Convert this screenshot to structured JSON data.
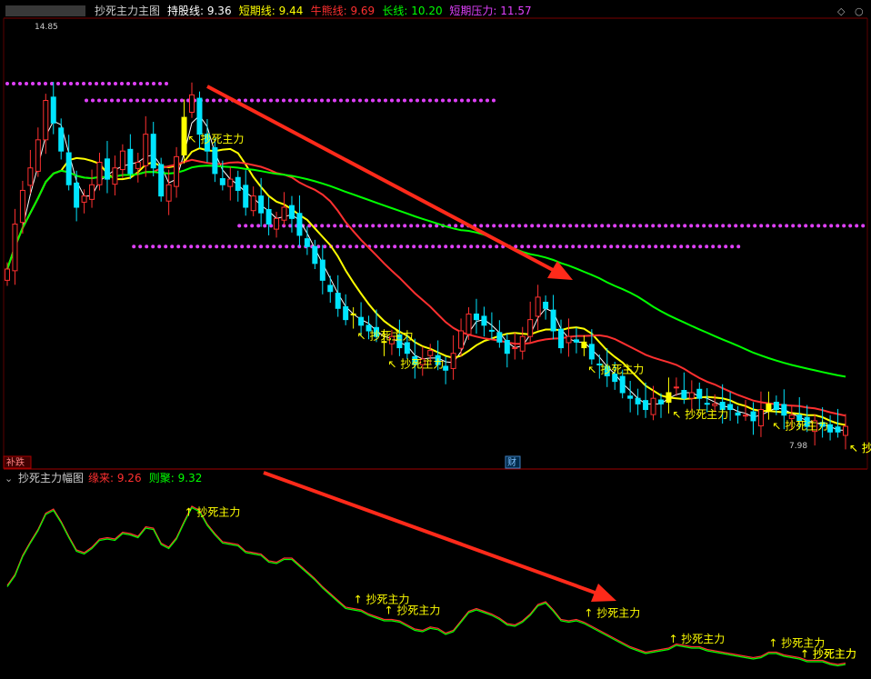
{
  "main_panel": {
    "title": "抄死主力主图",
    "indicators": [
      {
        "label": "持股线",
        "value": "9.36",
        "color": "#ffffff"
      },
      {
        "label": "短期线",
        "value": "9.44",
        "color": "#ffff00"
      },
      {
        "label": "牛熊线",
        "value": "9.69",
        "color": "#ff3030"
      },
      {
        "label": "长线",
        "value": "10.20",
        "color": "#00ff00"
      },
      {
        "label": "短期压力",
        "value": "11.57",
        "color": "#e040fb"
      }
    ],
    "price_high_label": "14.85",
    "price_low_label": "7.98",
    "badge_left": "补跌",
    "badge_mid": "财"
  },
  "sub_panel": {
    "title": "抄死主力幅图",
    "indicators": [
      {
        "label": "缘来",
        "value": "9.26",
        "color": "#ff3030"
      },
      {
        "label": "则聚",
        "value": "9.32",
        "color": "#00ff00"
      }
    ]
  },
  "signal_text": "抄死主力",
  "colors": {
    "up": "#ff3030",
    "down": "#00e5ff",
    "signal": "#ffff00",
    "pressure": "#e040fb",
    "arrow": "#ff2a1a"
  },
  "chart_data": [
    {
      "type": "candlestick",
      "title": "抄死主力主图",
      "ylim": [
        7.5,
        15.2
      ],
      "closes": [
        10.8,
        11.6,
        12.2,
        12.6,
        13.1,
        13.8,
        13.4,
        12.9,
        12.3,
        11.9,
        12.1,
        12.3,
        12.7,
        12.4,
        12.6,
        12.9,
        12.5,
        12.7,
        13.2,
        12.6,
        12.1,
        12.3,
        12.8,
        13.5,
        13.9,
        13.2,
        12.9,
        12.5,
        12.3,
        12.4,
        12.2,
        11.9,
        12.1,
        11.8,
        11.6,
        11.7,
        11.9,
        11.7,
        11.4,
        11.2,
        10.9,
        10.6,
        10.4,
        10.1,
        9.9,
        10.0,
        9.8,
        9.7,
        9.6,
        9.5,
        9.6,
        9.4,
        9.3,
        9.1,
        9.2,
        9.35,
        9.1,
        9.0,
        9.3,
        9.7,
        10.0,
        9.9,
        9.8,
        9.7,
        9.5,
        9.3,
        9.4,
        9.6,
        9.9,
        10.3,
        10.1,
        9.7,
        9.4,
        9.6,
        9.5,
        9.4,
        9.2,
        9.1,
        8.9,
        8.8,
        8.6,
        8.5,
        8.4,
        8.3,
        8.5,
        8.4,
        8.6,
        8.7,
        8.5,
        8.6,
        8.5,
        8.4,
        8.4,
        8.3,
        8.3,
        8.2,
        8.2,
        8.1,
        8.3,
        8.4,
        8.3,
        8.2,
        8.2,
        8.1,
        8.0,
        8.1,
        8.0,
        7.9,
        7.9,
        8.0
      ],
      "ma_lines": [
        {
          "name": "持股线",
          "color": "#ffffff"
        },
        {
          "name": "短期线",
          "color": "#ffff00"
        },
        {
          "name": "牛熊线",
          "color": "#ff3030"
        },
        {
          "name": "长线",
          "color": "#00ff00"
        }
      ],
      "pressure_levels": [
        14.1,
        13.8,
        11.57,
        11.2
      ],
      "signal_indices": [
        23,
        45,
        49,
        75,
        86,
        99,
        111,
        126
      ],
      "trend_arrow": {
        "from_value": 13.0,
        "to_value": 10.3
      }
    },
    {
      "type": "line",
      "title": "抄死主力幅图",
      "series": [
        {
          "name": "缘来",
          "color": "#ff3030"
        },
        {
          "name": "则聚",
          "color": "#00ff00"
        }
      ],
      "ylim": [
        0,
        1
      ]
    }
  ]
}
